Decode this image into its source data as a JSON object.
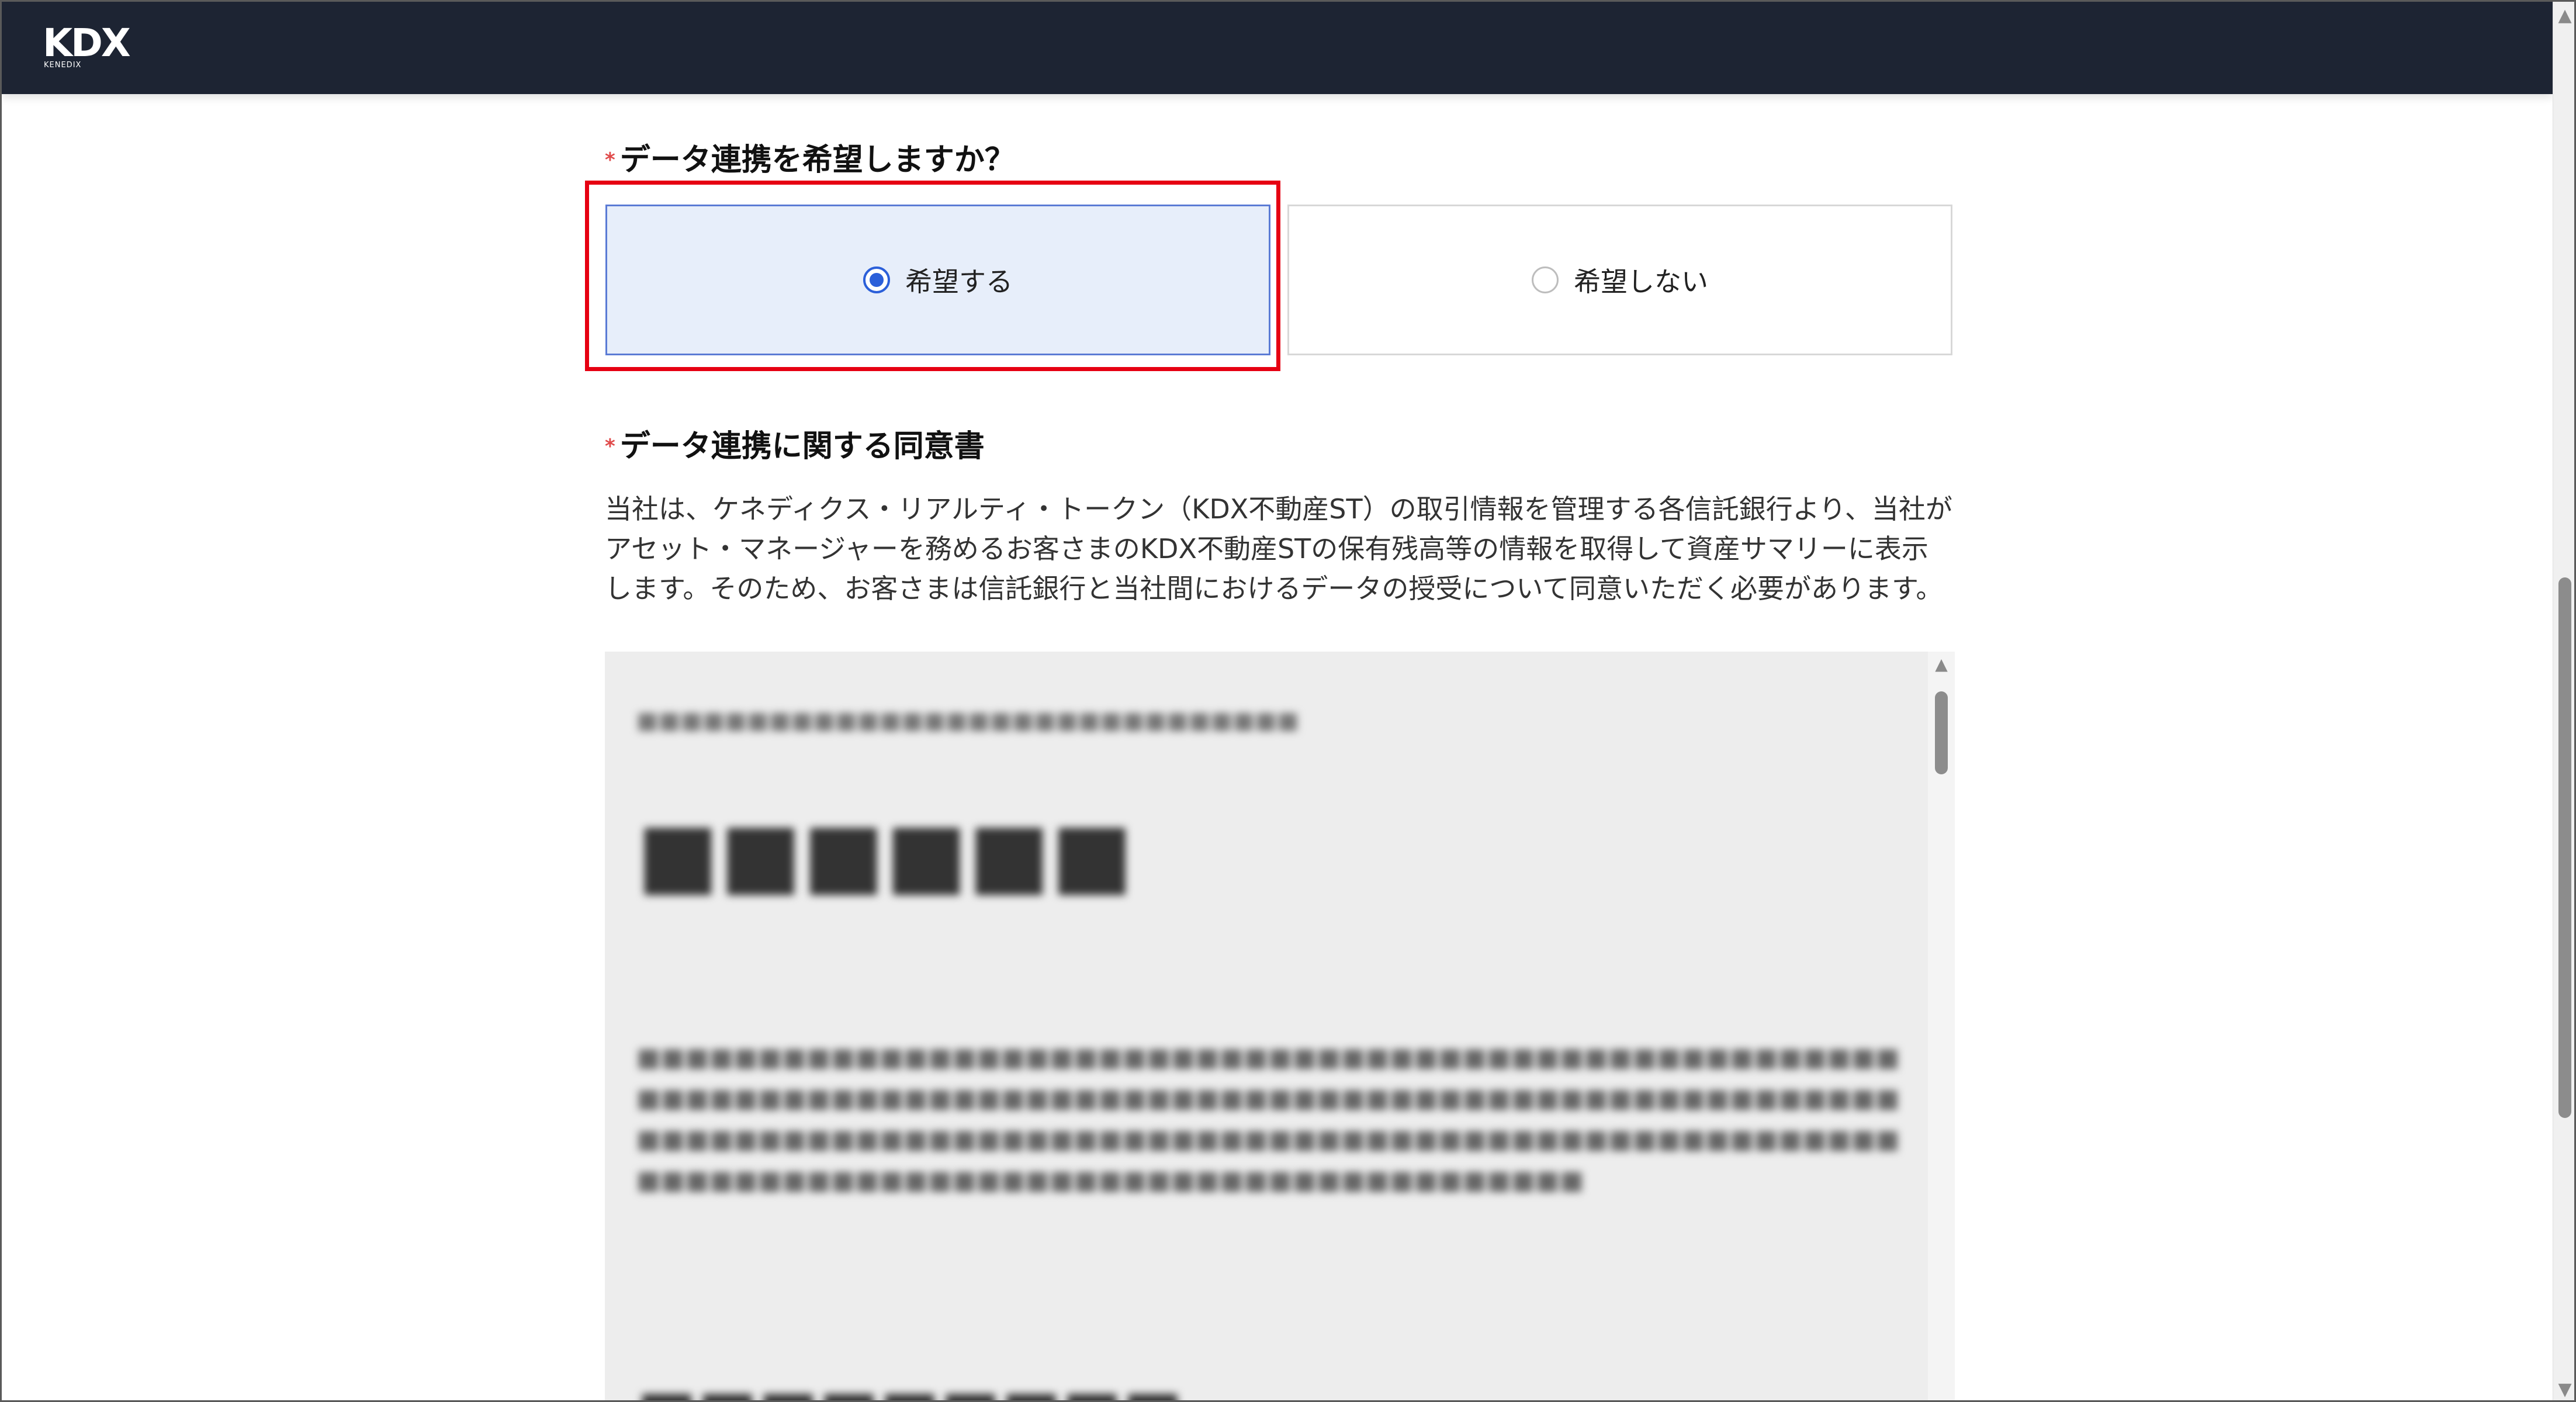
{
  "header": {
    "logo_text": "KDX",
    "logo_subtext": "KENEDIX"
  },
  "question": {
    "required_mark": "*",
    "title": "データ連携を希望しますか？",
    "options": [
      {
        "label": "希望する",
        "selected": true
      },
      {
        "label": "希望しない",
        "selected": false
      }
    ]
  },
  "consent": {
    "required_mark": "*",
    "title": "データ連携に関する同意書",
    "description": "当社は、ケネディクス・リアルティ・トークン（KDX不動産ST）の取引情報を管理する各信託銀行より、当社がアセット・マネージャーを務めるお客さまのKDX不動産STの保有残高等の情報を取得して資産サマリーに表示します。そのため、お客さまは信託銀行と当社間におけるデータの授受について同意いただく必要があります。"
  },
  "colors": {
    "header_bg": "#1d2433",
    "selected_bg": "#e7eefa",
    "selected_border": "#5b7bd5",
    "radio_accent": "#2b5fd9",
    "highlight_outline": "#e60012",
    "required_mark": "#e04a4a"
  }
}
